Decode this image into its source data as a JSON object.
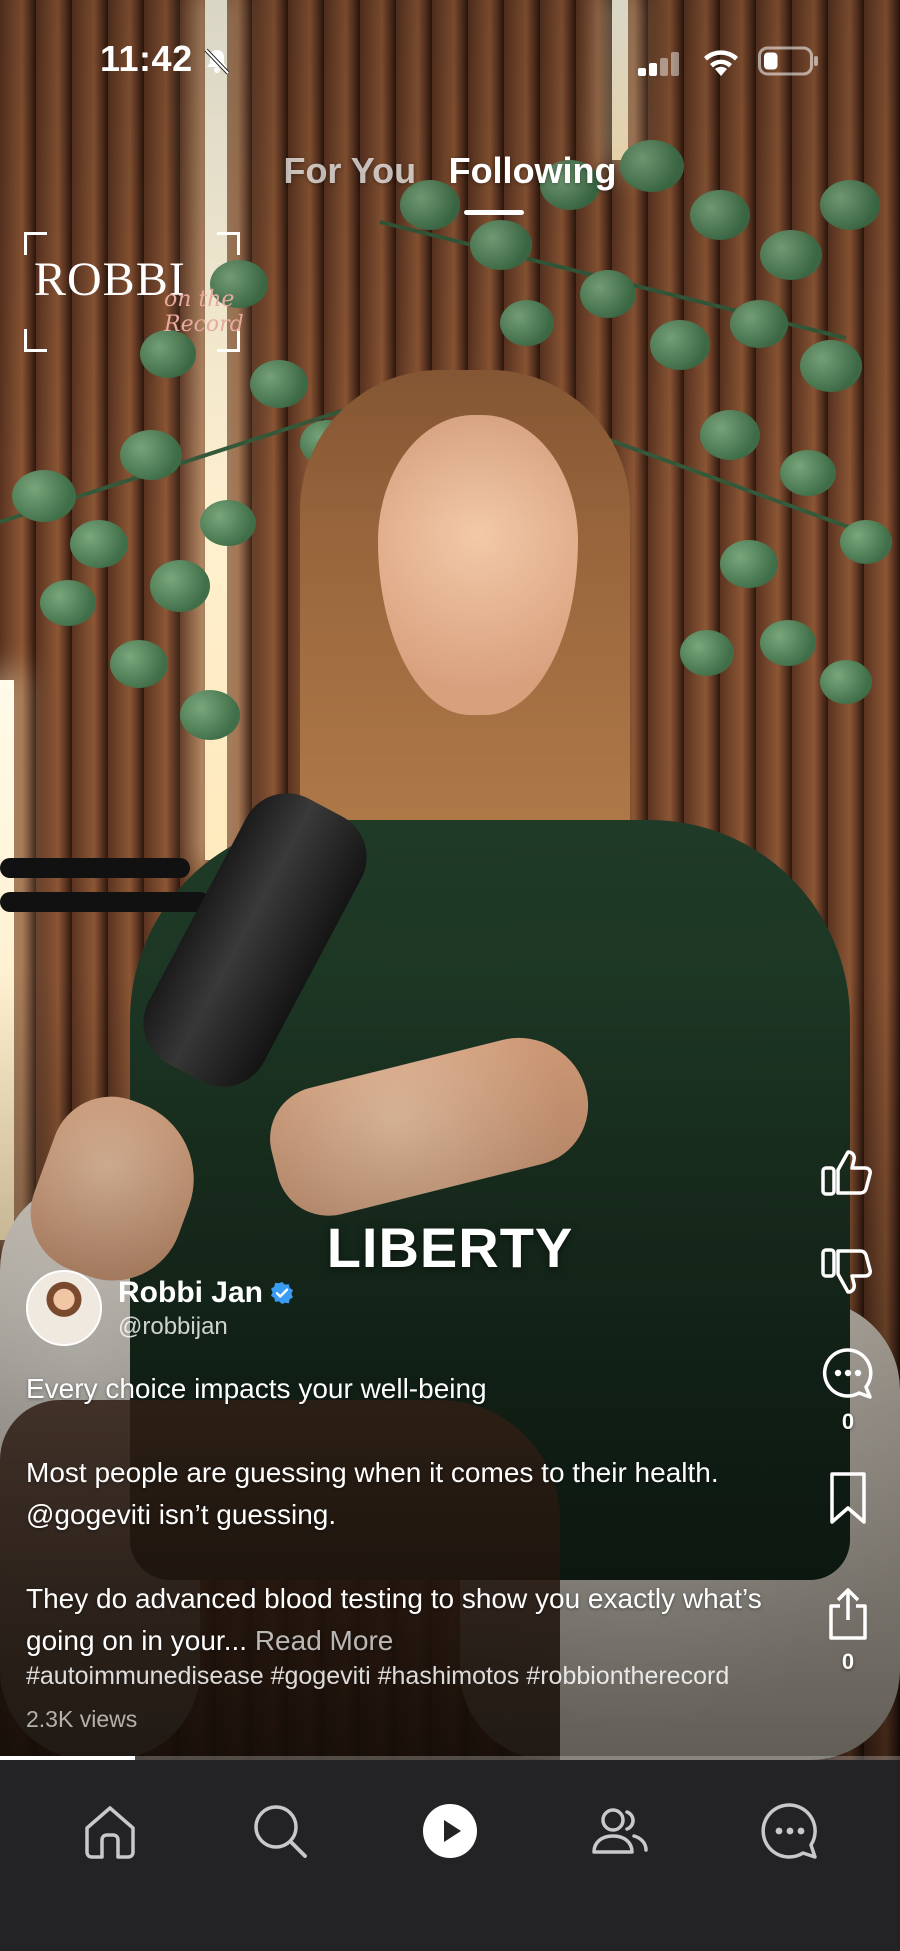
{
  "status_bar": {
    "time": "11:42",
    "battery_level": 0.3
  },
  "tabs": [
    {
      "label": "For You",
      "active": false
    },
    {
      "label": "Following",
      "active": true
    }
  ],
  "watermark": {
    "brand": "ROBBI",
    "script": "on the Record"
  },
  "video": {
    "caption_overlay": "LIBERTY",
    "progress": 0.15
  },
  "creator": {
    "name": "Robbi Jan",
    "handle": "@robbijan",
    "verified": true
  },
  "post": {
    "line1": "Every choice impacts your well-being",
    "line2": "Most people are guessing when it comes to their health.",
    "line3": "@gogeviti isn’t guessing.",
    "line4": "They do advanced blood testing to show you exactly what’s",
    "line5": "going on in your...",
    "read_more": "Read More",
    "hashtags": "#autoimmunedisease #gogeviti #hashimotos #robbiontherecord",
    "views": "2.3K views"
  },
  "actions": {
    "like_icon": "thumbs-up-icon",
    "dislike_icon": "thumbs-down-icon",
    "comment_icon": "comment-icon",
    "comment_count": "0",
    "bookmark_icon": "bookmark-icon",
    "share_icon": "share-icon",
    "share_count": "0"
  },
  "bottom_nav": {
    "items": [
      {
        "name": "home",
        "icon": "home-icon"
      },
      {
        "name": "search",
        "icon": "search-icon"
      },
      {
        "name": "play",
        "icon": "play-icon",
        "active": true
      },
      {
        "name": "following",
        "icon": "people-icon"
      },
      {
        "name": "messages",
        "icon": "chat-icon"
      }
    ]
  },
  "colors": {
    "nav_bg": "#232325",
    "verified": "#3b9cf5",
    "accent_white": "#ffffff"
  }
}
